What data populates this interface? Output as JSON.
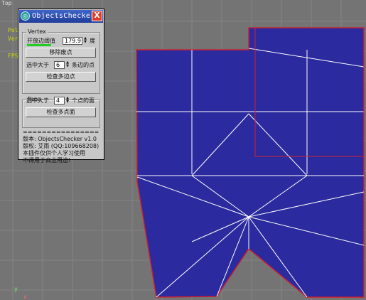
{
  "viewport": {
    "name": "Top",
    "stat_line1": "Pol",
    "stat_line2": "Ver",
    "fps_label": "FPS",
    "axis_y": "y",
    "axis_x": "x",
    "colors": {
      "background": "#747474",
      "grid": "#848484",
      "mesh_fill": "#2b2a9e",
      "mesh_border": "#cc2030",
      "edges": "#ffffff"
    }
  },
  "window": {
    "title": "ObjectsChecker",
    "app_icon": "3ds-max-icon",
    "close_label": "X",
    "vertex": {
      "group_label": "Vertex",
      "threshold_label": "开放边阈值",
      "threshold_value": "179.9",
      "threshold_unit": "度",
      "remove_button": "移除废点",
      "select_prefix": "选中大于",
      "select_value": "6",
      "select_suffix": "条边的点",
      "check_button": "检查多边点"
    },
    "face": {
      "group_label": "Face",
      "select_prefix": "选中大于",
      "select_value": "4",
      "select_suffix": "个点的面",
      "check_button": "检查多点面"
    },
    "info": {
      "separator": "================================",
      "version": "版本: ObjectsChecker v1.0",
      "copyright": "版权: 艾雨 (QQ:109668208)",
      "notice1": "本插件仅供个人学习使用",
      "notice2": "不得用于商业用途!"
    }
  }
}
